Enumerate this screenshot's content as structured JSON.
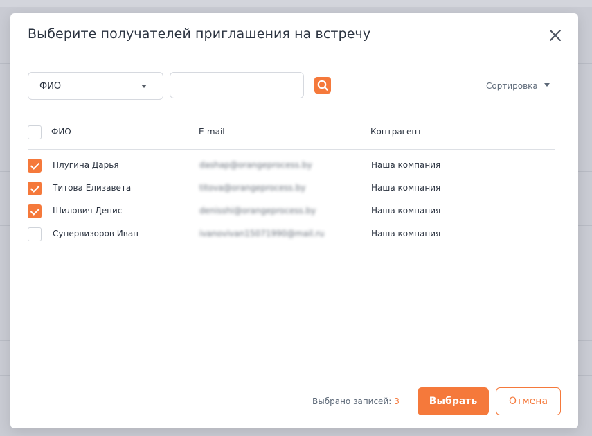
{
  "modal": {
    "title": "Выберите получателей приглашения на встречу",
    "close_icon": "close-icon"
  },
  "filter": {
    "field_value": "ФИО",
    "search_value": "",
    "search_icon": "search-icon",
    "sort_label": "Сортировка"
  },
  "table": {
    "columns": [
      "ФИО",
      "E-mail",
      "Контрагент"
    ],
    "rows": [
      {
        "checked": true,
        "name": "Плугина Дарья",
        "email": "dashap@orangeprocess.by",
        "company": "Наша компания"
      },
      {
        "checked": true,
        "name": "Титова Елизавета",
        "email": "titova@orangeprocess.by",
        "company": "Наша компания"
      },
      {
        "checked": true,
        "name": "Шилович Денис",
        "email": "denisshi@orangeprocess.by",
        "company": "Наша компания"
      },
      {
        "checked": false,
        "name": "Супервизоров Иван",
        "email": "ivanovivan15071990@mail.ru",
        "company": "Наша компания"
      }
    ]
  },
  "footer": {
    "selected_label": "Выбрано записей:",
    "selected_count": "3",
    "select_button": "Выбрать",
    "cancel_button": "Отмена"
  },
  "colors": {
    "accent": "#f5793b",
    "text": "#2b3340",
    "muted": "#5d6978",
    "border": "#d6d9df"
  }
}
